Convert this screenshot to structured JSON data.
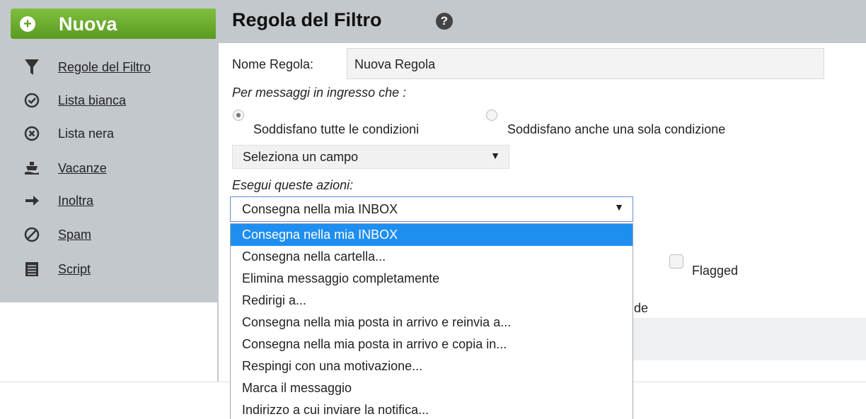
{
  "sidebar": {
    "new_button_label": "Nuova",
    "items": [
      {
        "label": "Regole del Filtro",
        "icon": "funnel-icon"
      },
      {
        "label": "Lista bianca",
        "icon": "check-circle-icon"
      },
      {
        "label": "Lista nera",
        "icon": "x-circle-icon"
      },
      {
        "label": "Vacanze",
        "icon": "cruise-ship-icon"
      },
      {
        "label": "Inoltra",
        "icon": "arrow-right-icon"
      },
      {
        "label": "Spam",
        "icon": "prohibited-icon"
      },
      {
        "label": "Script",
        "icon": "document-lines-icon"
      }
    ]
  },
  "header": {
    "title": "Regola del Filtro",
    "help_icon": "question-circle-icon",
    "help_glyph": "?"
  },
  "form": {
    "name_label": "Nome Regola:",
    "name_value": "Nuova Regola",
    "incoming_label": "Per messaggi in ingresso che :",
    "radio_all": "Soddisfano tutte le condizioni",
    "radio_any": "Soddisfano anche una sola condizione",
    "field_select": "Seleziona un campo",
    "actions_label": "Esegui queste azioni:",
    "action_select": "Consegna nella mia INBOX",
    "flagged_label": "Flagged",
    "partial_text": "de"
  },
  "dropdown": {
    "options": [
      "Consegna nella mia INBOX",
      "Consegna nella cartella...",
      "Elimina messaggio completamente",
      "Redirigi a...",
      "Consegna nella mia posta in arrivo e reinvia a...",
      "Consegna nella mia posta in arrivo e copia in...",
      "Respingi con una motivazione...",
      "Marca il messaggio",
      "Indirizzo a cui inviare la notifica..."
    ],
    "selected_index": 0
  },
  "colors": {
    "sidebar_bg": "#c3c8cd",
    "new_button": "#6aab2e",
    "selection": "#1f8ef1"
  }
}
